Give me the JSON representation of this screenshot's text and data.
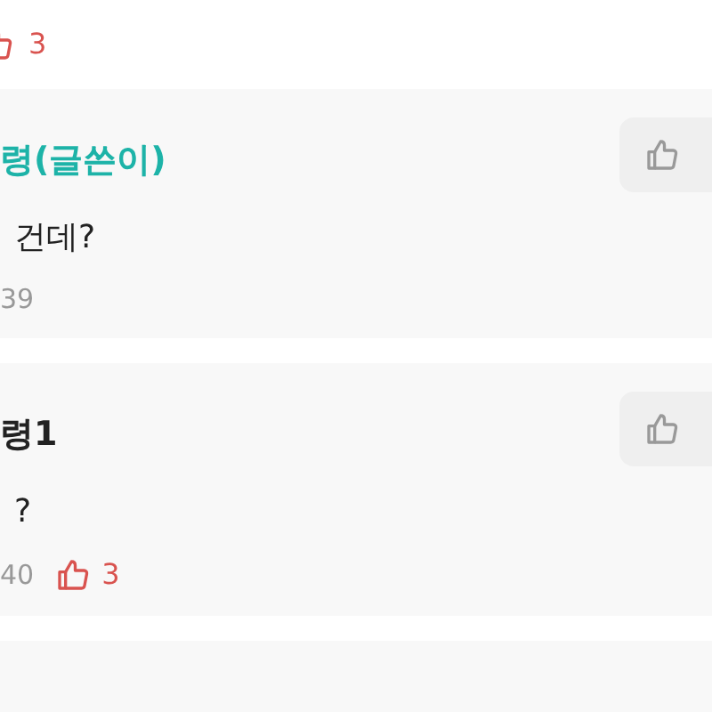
{
  "previous_comment": {
    "like_count": "3"
  },
  "comments": [
    {
      "author": "령(글쓴이)",
      "is_writer": true,
      "text": "건데?",
      "time": "39"
    },
    {
      "author": "령1",
      "is_writer": false,
      "text": "?",
      "time": "40",
      "like_count": "3"
    }
  ]
}
